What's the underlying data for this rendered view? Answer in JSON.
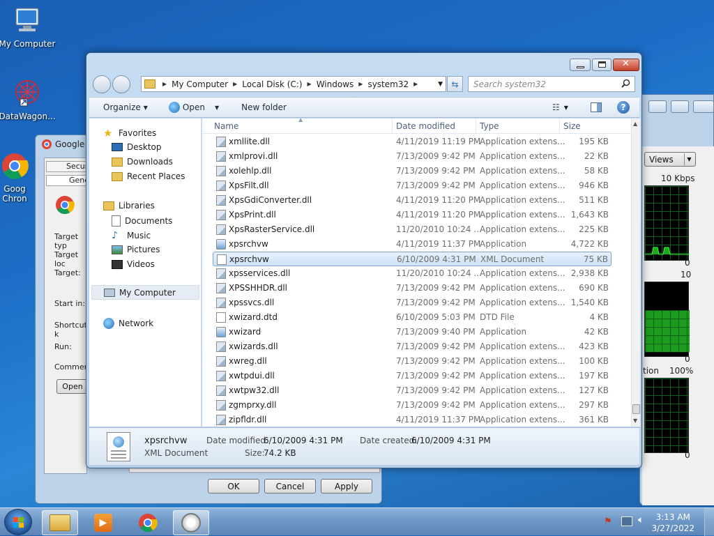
{
  "desktop": {
    "icons": [
      {
        "label": "My Computer"
      },
      {
        "label": "DataWagon..."
      },
      {
        "label": "Goog\nChron"
      }
    ]
  },
  "bg_properties": {
    "title": "Google C",
    "tabs": [
      "Secur",
      "Gene"
    ],
    "labels": [
      "Target typ",
      "Target loc",
      "Target:",
      "Start in:",
      "Shortcut k",
      "Run:",
      "Comment",
      "Open"
    ],
    "buttons": {
      "ok": "OK",
      "cancel": "Cancel",
      "apply": "Apply"
    }
  },
  "bg_taskmgr": {
    "views_label": "Views",
    "graph1_top": "10 Kbps",
    "graph1_bottom": "0",
    "graph2_top": "10",
    "graph2_bottom": "0",
    "graph3_label": "tion",
    "graph3_top": "100%",
    "graph3_bottom": "0"
  },
  "explorer": {
    "breadcrumb": [
      "My Computer",
      "Local Disk (C:)",
      "Windows",
      "system32"
    ],
    "search_placeholder": "Search system32",
    "toolbar": {
      "organize": "Organize",
      "open": "Open",
      "new_folder": "New folder"
    },
    "nav": {
      "favorites": "Favorites",
      "desktop": "Desktop",
      "downloads": "Downloads",
      "recent": "Recent Places",
      "libraries": "Libraries",
      "documents": "Documents",
      "music": "Music",
      "pictures": "Pictures",
      "videos": "Videos",
      "computer": "My Computer",
      "network": "Network"
    },
    "columns": {
      "name": "Name",
      "date": "Date modified",
      "type": "Type",
      "size": "Size"
    },
    "files": [
      {
        "name": "xmllite.dll",
        "date": "4/11/2019 11:19 PM",
        "type": "Application extens...",
        "size": "195 KB",
        "icon": "dll-icon"
      },
      {
        "name": "xmlprovi.dll",
        "date": "7/13/2009 9:42 PM",
        "type": "Application extens...",
        "size": "22 KB",
        "icon": "dll-icon"
      },
      {
        "name": "xolehlp.dll",
        "date": "7/13/2009 9:42 PM",
        "type": "Application extens...",
        "size": "58 KB",
        "icon": "dll-icon"
      },
      {
        "name": "XpsFilt.dll",
        "date": "7/13/2009 9:42 PM",
        "type": "Application extens...",
        "size": "946 KB",
        "icon": "dll-icon"
      },
      {
        "name": "XpsGdiConverter.dll",
        "date": "4/11/2019 11:20 PM",
        "type": "Application extens...",
        "size": "511 KB",
        "icon": "dll-icon"
      },
      {
        "name": "XpsPrint.dll",
        "date": "4/11/2019 11:20 PM",
        "type": "Application extens...",
        "size": "1,643 KB",
        "icon": "dll-icon"
      },
      {
        "name": "XpsRasterService.dll",
        "date": "11/20/2010 10:24 ...",
        "type": "Application extens...",
        "size": "225 KB",
        "icon": "dll-icon"
      },
      {
        "name": "xpsrchvw",
        "date": "4/11/2019 11:37 PM",
        "type": "Application",
        "size": "4,722 KB",
        "icon": "app-icon"
      },
      {
        "name": "xpsrchvw",
        "date": "6/10/2009 4:31 PM",
        "type": "XML Document",
        "size": "75 KB",
        "icon": "xml-icon",
        "selected": true
      },
      {
        "name": "xpsservices.dll",
        "date": "11/20/2010 10:24 ...",
        "type": "Application extens...",
        "size": "2,938 KB",
        "icon": "dll-icon"
      },
      {
        "name": "XPSSHHDR.dll",
        "date": "7/13/2009 9:42 PM",
        "type": "Application extens...",
        "size": "690 KB",
        "icon": "dll-icon"
      },
      {
        "name": "xpssvcs.dll",
        "date": "7/13/2009 9:42 PM",
        "type": "Application extens...",
        "size": "1,540 KB",
        "icon": "dll-icon"
      },
      {
        "name": "xwizard.dtd",
        "date": "6/10/2009 5:03 PM",
        "type": "DTD File",
        "size": "4 KB",
        "icon": "file-icon"
      },
      {
        "name": "xwizard",
        "date": "7/13/2009 9:40 PM",
        "type": "Application",
        "size": "42 KB",
        "icon": "app-icon"
      },
      {
        "name": "xwizards.dll",
        "date": "7/13/2009 9:42 PM",
        "type": "Application extens...",
        "size": "423 KB",
        "icon": "dll-icon"
      },
      {
        "name": "xwreg.dll",
        "date": "7/13/2009 9:42 PM",
        "type": "Application extens...",
        "size": "100 KB",
        "icon": "dll-icon"
      },
      {
        "name": "xwtpdui.dll",
        "date": "7/13/2009 9:42 PM",
        "type": "Application extens...",
        "size": "197 KB",
        "icon": "dll-icon"
      },
      {
        "name": "xwtpw32.dll",
        "date": "7/13/2009 9:42 PM",
        "type": "Application extens...",
        "size": "127 KB",
        "icon": "dll-icon"
      },
      {
        "name": "zgmprxy.dll",
        "date": "7/13/2009 9:42 PM",
        "type": "Application extens...",
        "size": "297 KB",
        "icon": "dll-icon"
      },
      {
        "name": "zipfldr.dll",
        "date": "4/11/2019 11:37 PM",
        "type": "Application extens...",
        "size": "361 KB",
        "icon": "dll-icon"
      }
    ],
    "details": {
      "name": "xpsrchvw",
      "type": "XML Document",
      "modified_label": "Date modified:",
      "modified_value": "6/10/2009 4:31 PM",
      "created_label": "Date created:",
      "created_value": "6/10/2009 4:31 PM",
      "size_label": "Size:",
      "size_value": "74.2 KB"
    }
  },
  "taskbar": {
    "time": "3:13 AM",
    "date": "3/27/2022"
  }
}
